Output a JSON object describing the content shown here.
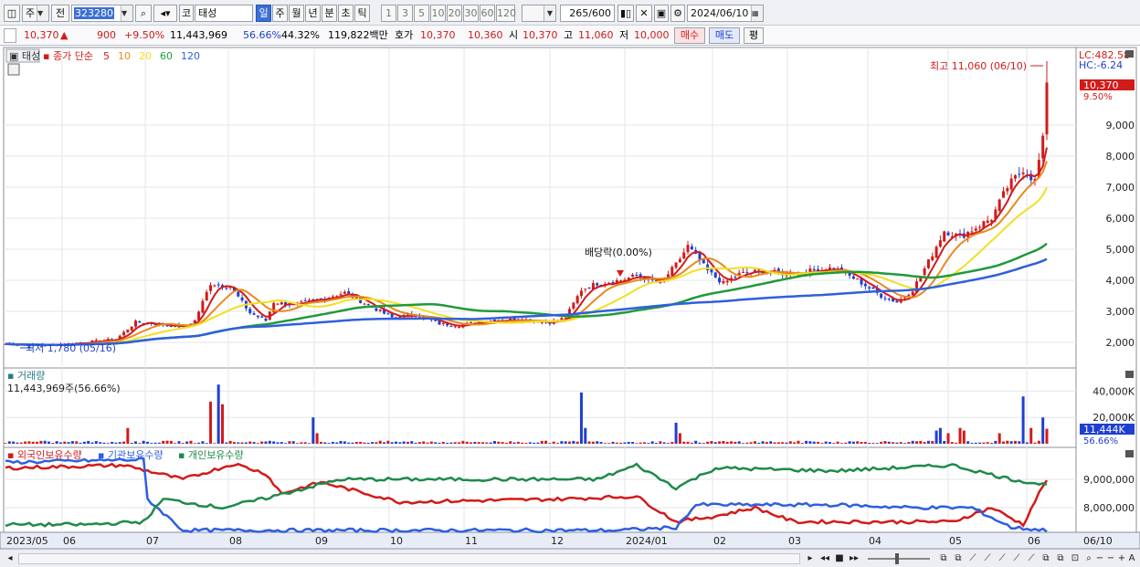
{
  "toolbar": {
    "market_label": "주",
    "prev_label": "전",
    "code": "323280",
    "type_label": "코",
    "stock_name": "태성",
    "periods": [
      "일",
      "주",
      "월",
      "년",
      "분",
      "초",
      "틱"
    ],
    "active_period": "일",
    "intervals": [
      "1",
      "3",
      "5",
      "10",
      "20",
      "30",
      "60",
      "120"
    ],
    "count": "265",
    "count_max": "/600",
    "date": "2024/06/10"
  },
  "quote": {
    "price": "10,370",
    "change_arrow": "▲",
    "change": "900",
    "change_pct": "+9.50%",
    "volume": "11,443,969",
    "vol_ratio": "56.66%",
    "turnover": "44.32%",
    "amount": "119,822백만",
    "ask_label": "호가",
    "ask1": "10,370",
    "ask2": "10,360",
    "open_label": "시",
    "open": "10,370",
    "high_label": "고",
    "high": "11,060",
    "low_label": "저",
    "low": "10,000",
    "buy_label": "매수",
    "sell_label": "매도",
    "eval_label": "평"
  },
  "price_panel": {
    "legend_name": "태성",
    "ma_label": "종가 단순",
    "ma_periods": [
      "5",
      "10",
      "20",
      "60",
      "120"
    ],
    "ma_colors": [
      "#d21b1b",
      "#e88a1e",
      "#f0e020",
      "#1f9a3a",
      "#2f5fe0"
    ],
    "high_note": "최고 11,060 (06/10)",
    "low_note": "최저 1,780 (05/16)",
    "dividend_note": "배당락(0.00%)",
    "lc": "LC:482.58",
    "hc": "HC:-6.24",
    "last_price_tag": "10,370",
    "last_pct": "9.50%",
    "y_ticks": [
      "9,000",
      "8,000",
      "7,000",
      "6,000",
      "5,000",
      "4,000",
      "3,000",
      "2,000"
    ]
  },
  "volume_panel": {
    "title": "거래량",
    "value": "11,443,969주(56.66%)",
    "y_ticks": [
      "40,000K",
      "20,000K"
    ],
    "last_tag": "11,444K",
    "last_pct": "56.66%"
  },
  "holding_panel": {
    "series_labels": [
      "외국인보유수량",
      "기관보유수량",
      "개인보유수량"
    ],
    "series_colors": [
      "#d21b1b",
      "#2f5fe0",
      "#1f8a4a"
    ],
    "y_ticks": [
      "9,000,000",
      "8,000,000"
    ]
  },
  "x_axis": {
    "labels": [
      "2023/05",
      "06",
      "07",
      "08",
      "09",
      "10",
      "11",
      "12",
      "2024/01",
      "02",
      "03",
      "04",
      "05",
      "06"
    ],
    "right_label": "06/10"
  }
}
